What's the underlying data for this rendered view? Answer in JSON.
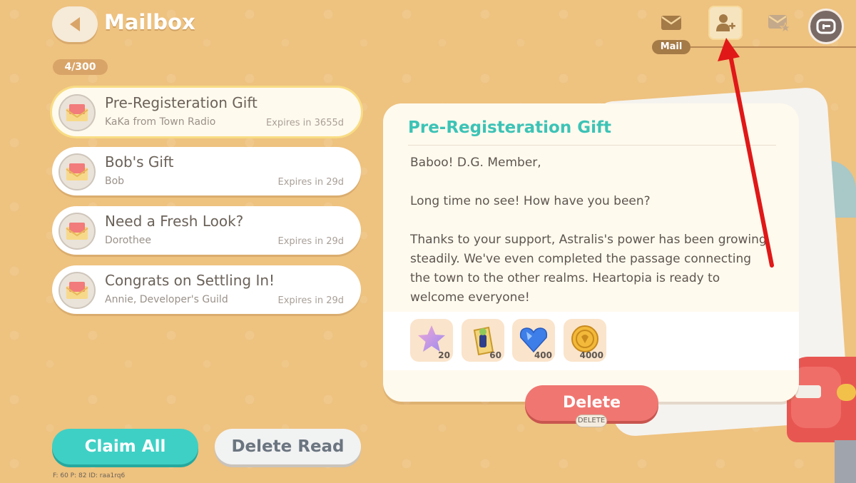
{
  "header": {
    "title": "Mailbox",
    "count": "4/300"
  },
  "tabs": {
    "mail_label": "Mail",
    "items": [
      {
        "icon": "envelope-icon"
      },
      {
        "icon": "add-friend-icon"
      },
      {
        "icon": "starred-mail-icon"
      }
    ]
  },
  "mails": [
    {
      "title": "Pre-Registeration Gift",
      "sender": "KaKa from Town Radio",
      "expiry": "Expires in 3655d",
      "selected": true
    },
    {
      "title": "Bob's Gift",
      "sender": "Bob",
      "expiry": "Expires in 29d"
    },
    {
      "title": "Need a Fresh Look?",
      "sender": "Dorothee",
      "expiry": "Expires in 29d"
    },
    {
      "title": "Congrats on Settling In!",
      "sender": "Annie, Developer's Guild",
      "expiry": "Expires in 29d"
    }
  ],
  "detail": {
    "title": "Pre-Registeration Gift",
    "paragraphs": [
      "Baboo! D.G. Member,",
      "Long time no see! How have you been?",
      "Thanks to your support, Astralis's power has been growing steadily. We've even completed the passage connecting the town to the other realms. Heartopia is ready to welcome everyone!"
    ],
    "rewards": [
      {
        "icon": "star-icon",
        "qty": "20"
      },
      {
        "icon": "badge-icon",
        "qty": "60"
      },
      {
        "icon": "heart-gem-icon",
        "qty": "400"
      },
      {
        "icon": "coin-icon",
        "qty": "4000"
      }
    ],
    "delete_label": "Delete",
    "delete_hint": "DELETE"
  },
  "footer": {
    "claim_all": "Claim All",
    "delete_read": "Delete Read",
    "debug": "F: 60    P: 82    ID: raa1rq6"
  },
  "colors": {
    "background": "#eec27f",
    "accent_teal": "#3fd0c5",
    "delete_red": "#f07671",
    "annotation_arrow": "#e01818"
  }
}
